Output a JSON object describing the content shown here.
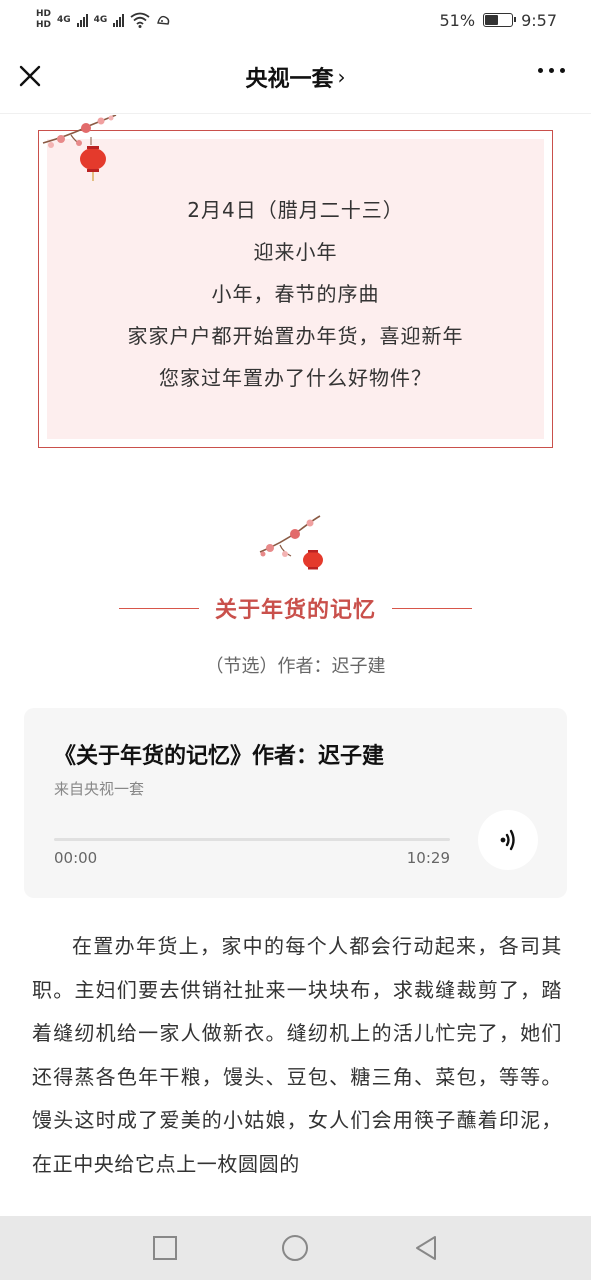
{
  "status_bar": {
    "hd_top": "HD",
    "hd_bottom": "HD",
    "net_1": "4G",
    "net_2": "4G",
    "battery_percent": "51%",
    "battery_level": 0.51,
    "time": "9:57"
  },
  "nav": {
    "title": "央视一套",
    "chevron": "›"
  },
  "intro": {
    "lines": [
      "2月4日（腊月二十三）",
      "迎来小年",
      "小年，春节的序曲",
      "家家户户都开始置办年货，喜迎新年",
      "您家过年置办了什么好物件？"
    ]
  },
  "section": {
    "title": "关于年货的记忆",
    "subtitle": "（节选）作者：迟子建"
  },
  "audio": {
    "title": "《关于年货的记忆》作者：迟子建",
    "source": "来自央视一套",
    "current_time": "00:00",
    "duration": "10:29",
    "progress": 0
  },
  "article": {
    "paragraph": "在置办年货上，家中的每个人都会行动起来，各司其职。主妇们要去供销社扯来一块块布，求裁缝裁剪了，踏着缝纫机给一家人做新衣。缝纫机上的活儿忙完了，她们还得蒸各色年干粮，馒头、豆包、糖三角、菜包，等等。馒头这时成了爱美的小姑娘，女人们会用筷子蘸着印泥，在正中央给它点上一枚圆圆的"
  },
  "colors": {
    "accent_red": "#c9504b",
    "intro_bg": "#fdeeee",
    "card_bg": "#f6f6f6",
    "sys_nav_bg": "#e8e8e8"
  }
}
